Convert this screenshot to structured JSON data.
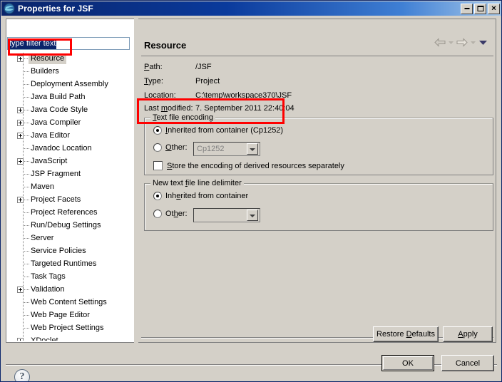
{
  "window": {
    "title": "Properties for JSF",
    "icon": "eclipse-sphere-icon",
    "minimize_label": "Minimize",
    "maximize_label": "Maximize",
    "close_label": "Close"
  },
  "sidebar": {
    "filter": {
      "value": "type filter text",
      "placeholder": "type filter text",
      "selected": true
    },
    "items": [
      {
        "label": "Resource",
        "expandable": true,
        "selected": true
      },
      {
        "label": "Builders",
        "expandable": false,
        "selected": false
      },
      {
        "label": "Deployment Assembly",
        "expandable": false,
        "selected": false
      },
      {
        "label": "Java Build Path",
        "expandable": false,
        "selected": false
      },
      {
        "label": "Java Code Style",
        "expandable": true,
        "selected": false
      },
      {
        "label": "Java Compiler",
        "expandable": true,
        "selected": false
      },
      {
        "label": "Java Editor",
        "expandable": true,
        "selected": false
      },
      {
        "label": "Javadoc Location",
        "expandable": false,
        "selected": false
      },
      {
        "label": "JavaScript",
        "expandable": true,
        "selected": false
      },
      {
        "label": "JSP Fragment",
        "expandable": false,
        "selected": false
      },
      {
        "label": "Maven",
        "expandable": false,
        "selected": false
      },
      {
        "label": "Project Facets",
        "expandable": true,
        "selected": false
      },
      {
        "label": "Project References",
        "expandable": false,
        "selected": false
      },
      {
        "label": "Run/Debug Settings",
        "expandable": false,
        "selected": false
      },
      {
        "label": "Server",
        "expandable": false,
        "selected": false
      },
      {
        "label": "Service Policies",
        "expandable": false,
        "selected": false
      },
      {
        "label": "Targeted Runtimes",
        "expandable": false,
        "selected": false
      },
      {
        "label": "Task Tags",
        "expandable": false,
        "selected": false
      },
      {
        "label": "Validation",
        "expandable": true,
        "selected": false
      },
      {
        "label": "Web Content Settings",
        "expandable": false,
        "selected": false
      },
      {
        "label": "Web Page Editor",
        "expandable": false,
        "selected": false
      },
      {
        "label": "Web Project Settings",
        "expandable": false,
        "selected": false
      },
      {
        "label": "XDoclet",
        "expandable": true,
        "selected": false
      }
    ]
  },
  "page": {
    "title": "Resource",
    "nav": {
      "back_label": "Back",
      "back_menu_label": "Back history",
      "forward_label": "Forward",
      "forward_menu_label": "Forward history",
      "menu_label": "View Menu"
    },
    "properties": [
      {
        "label": "Path:",
        "value": "/JSF",
        "mnemonic": "P"
      },
      {
        "label": "Type:",
        "value": "Project",
        "mnemonic": "T"
      },
      {
        "label": "Location:",
        "value": "C:\\temp\\workspace370\\JSF",
        "mnemonic": "L"
      },
      {
        "label": "Last modified:",
        "value": "7. September 2011 22:40:04",
        "mnemonic": "m"
      }
    ],
    "encoding_group": {
      "title": "Text file encoding",
      "title_pre": "T",
      "title_post": "ext file encoding",
      "inherited": {
        "label_pre": "I",
        "label_post": "nherited from container (Cp1252)",
        "label": "Inherited from container (Cp1252)",
        "selected": true
      },
      "other": {
        "label_pre": "O",
        "label_post": "ther:",
        "label": "Other:",
        "selected": false,
        "combo_value": "Cp1252",
        "combo_disabled": true
      },
      "store_checkbox": {
        "label_pre": "S",
        "label_post": "tore the encoding of derived resources separately",
        "label": "Store the encoding of derived resources separately",
        "checked": false
      }
    },
    "delimiter_group": {
      "title": "New text file line delimiter",
      "title_a": "New text ",
      "title_mn": "f",
      "title_b": "ile line delimiter",
      "inherited": {
        "label_a": "Inh",
        "label_mn": "e",
        "label_b": "rited from container",
        "label": "Inherited from container",
        "selected": true
      },
      "other": {
        "label_a": "Ot",
        "label_mn": "h",
        "label_b": "er:",
        "label": "Other:",
        "selected": false,
        "combo_value": "",
        "combo_disabled": false
      }
    }
  },
  "buttons": {
    "restore_defaults": {
      "pre": "Restore ",
      "mn": "D",
      "post": "efaults",
      "label": "Restore Defaults"
    },
    "apply": {
      "mn": "A",
      "post": "pply",
      "label": "Apply"
    },
    "ok": {
      "label": "OK",
      "is_default": true
    },
    "cancel": {
      "label": "Cancel"
    },
    "help": {
      "label": "?"
    }
  },
  "annotations": {
    "color": "#ff0000",
    "boxes": [
      {
        "name": "filter-and-resource-highlight"
      },
      {
        "name": "text-file-encoding-highlight"
      }
    ]
  }
}
